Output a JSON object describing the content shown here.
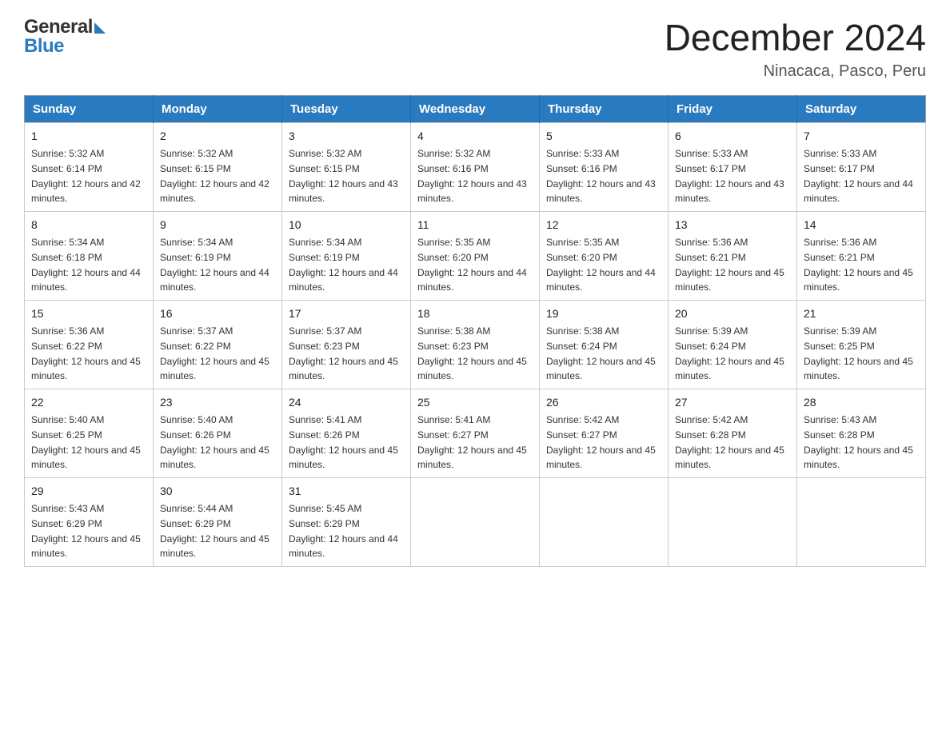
{
  "header": {
    "title": "December 2024",
    "location": "Ninacaca, Pasco, Peru"
  },
  "logo": {
    "part1": "General",
    "part2": "Blue"
  },
  "days_of_week": [
    "Sunday",
    "Monday",
    "Tuesday",
    "Wednesday",
    "Thursday",
    "Friday",
    "Saturday"
  ],
  "weeks": [
    [
      {
        "day": "1",
        "sunrise": "5:32 AM",
        "sunset": "6:14 PM",
        "daylight": "12 hours and 42 minutes."
      },
      {
        "day": "2",
        "sunrise": "5:32 AM",
        "sunset": "6:15 PM",
        "daylight": "12 hours and 42 minutes."
      },
      {
        "day": "3",
        "sunrise": "5:32 AM",
        "sunset": "6:15 PM",
        "daylight": "12 hours and 43 minutes."
      },
      {
        "day": "4",
        "sunrise": "5:32 AM",
        "sunset": "6:16 PM",
        "daylight": "12 hours and 43 minutes."
      },
      {
        "day": "5",
        "sunrise": "5:33 AM",
        "sunset": "6:16 PM",
        "daylight": "12 hours and 43 minutes."
      },
      {
        "day": "6",
        "sunrise": "5:33 AM",
        "sunset": "6:17 PM",
        "daylight": "12 hours and 43 minutes."
      },
      {
        "day": "7",
        "sunrise": "5:33 AM",
        "sunset": "6:17 PM",
        "daylight": "12 hours and 44 minutes."
      }
    ],
    [
      {
        "day": "8",
        "sunrise": "5:34 AM",
        "sunset": "6:18 PM",
        "daylight": "12 hours and 44 minutes."
      },
      {
        "day": "9",
        "sunrise": "5:34 AM",
        "sunset": "6:19 PM",
        "daylight": "12 hours and 44 minutes."
      },
      {
        "day": "10",
        "sunrise": "5:34 AM",
        "sunset": "6:19 PM",
        "daylight": "12 hours and 44 minutes."
      },
      {
        "day": "11",
        "sunrise": "5:35 AM",
        "sunset": "6:20 PM",
        "daylight": "12 hours and 44 minutes."
      },
      {
        "day": "12",
        "sunrise": "5:35 AM",
        "sunset": "6:20 PM",
        "daylight": "12 hours and 44 minutes."
      },
      {
        "day": "13",
        "sunrise": "5:36 AM",
        "sunset": "6:21 PM",
        "daylight": "12 hours and 45 minutes."
      },
      {
        "day": "14",
        "sunrise": "5:36 AM",
        "sunset": "6:21 PM",
        "daylight": "12 hours and 45 minutes."
      }
    ],
    [
      {
        "day": "15",
        "sunrise": "5:36 AM",
        "sunset": "6:22 PM",
        "daylight": "12 hours and 45 minutes."
      },
      {
        "day": "16",
        "sunrise": "5:37 AM",
        "sunset": "6:22 PM",
        "daylight": "12 hours and 45 minutes."
      },
      {
        "day": "17",
        "sunrise": "5:37 AM",
        "sunset": "6:23 PM",
        "daylight": "12 hours and 45 minutes."
      },
      {
        "day": "18",
        "sunrise": "5:38 AM",
        "sunset": "6:23 PM",
        "daylight": "12 hours and 45 minutes."
      },
      {
        "day": "19",
        "sunrise": "5:38 AM",
        "sunset": "6:24 PM",
        "daylight": "12 hours and 45 minutes."
      },
      {
        "day": "20",
        "sunrise": "5:39 AM",
        "sunset": "6:24 PM",
        "daylight": "12 hours and 45 minutes."
      },
      {
        "day": "21",
        "sunrise": "5:39 AM",
        "sunset": "6:25 PM",
        "daylight": "12 hours and 45 minutes."
      }
    ],
    [
      {
        "day": "22",
        "sunrise": "5:40 AM",
        "sunset": "6:25 PM",
        "daylight": "12 hours and 45 minutes."
      },
      {
        "day": "23",
        "sunrise": "5:40 AM",
        "sunset": "6:26 PM",
        "daylight": "12 hours and 45 minutes."
      },
      {
        "day": "24",
        "sunrise": "5:41 AM",
        "sunset": "6:26 PM",
        "daylight": "12 hours and 45 minutes."
      },
      {
        "day": "25",
        "sunrise": "5:41 AM",
        "sunset": "6:27 PM",
        "daylight": "12 hours and 45 minutes."
      },
      {
        "day": "26",
        "sunrise": "5:42 AM",
        "sunset": "6:27 PM",
        "daylight": "12 hours and 45 minutes."
      },
      {
        "day": "27",
        "sunrise": "5:42 AM",
        "sunset": "6:28 PM",
        "daylight": "12 hours and 45 minutes."
      },
      {
        "day": "28",
        "sunrise": "5:43 AM",
        "sunset": "6:28 PM",
        "daylight": "12 hours and 45 minutes."
      }
    ],
    [
      {
        "day": "29",
        "sunrise": "5:43 AM",
        "sunset": "6:29 PM",
        "daylight": "12 hours and 45 minutes."
      },
      {
        "day": "30",
        "sunrise": "5:44 AM",
        "sunset": "6:29 PM",
        "daylight": "12 hours and 45 minutes."
      },
      {
        "day": "31",
        "sunrise": "5:45 AM",
        "sunset": "6:29 PM",
        "daylight": "12 hours and 44 minutes."
      },
      null,
      null,
      null,
      null
    ]
  ]
}
